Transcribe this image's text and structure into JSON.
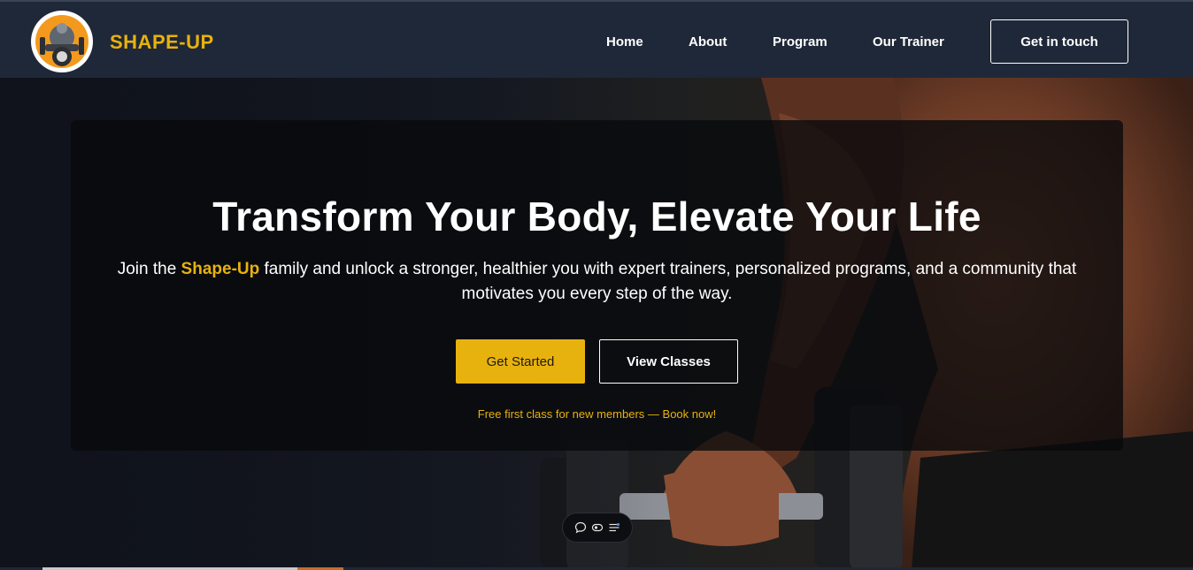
{
  "header": {
    "brand": "SHAPE-UP",
    "nav": [
      "Home",
      "About",
      "Program",
      "Our Trainer"
    ],
    "cta": "Get in touch"
  },
  "hero": {
    "title": "Transform Your Body, Elevate Your Life",
    "subtitle_before": "Join the ",
    "subtitle_highlight": "Shape-Up",
    "subtitle_after": " family and unlock a stronger, healthier you with expert trainers, personalized programs, and a community that motivates you every step of the way.",
    "primary_button": "Get Started",
    "secondary_button": "View Classes",
    "promo": "Free first class for new members — Book now!"
  },
  "toolbar": {
    "icons": [
      "chat-icon",
      "eye-icon",
      "settings-sliders-icon"
    ]
  },
  "colors": {
    "accent": "#e8b20e",
    "header_bg": "#1f2838",
    "card_bg": "#08090c"
  }
}
